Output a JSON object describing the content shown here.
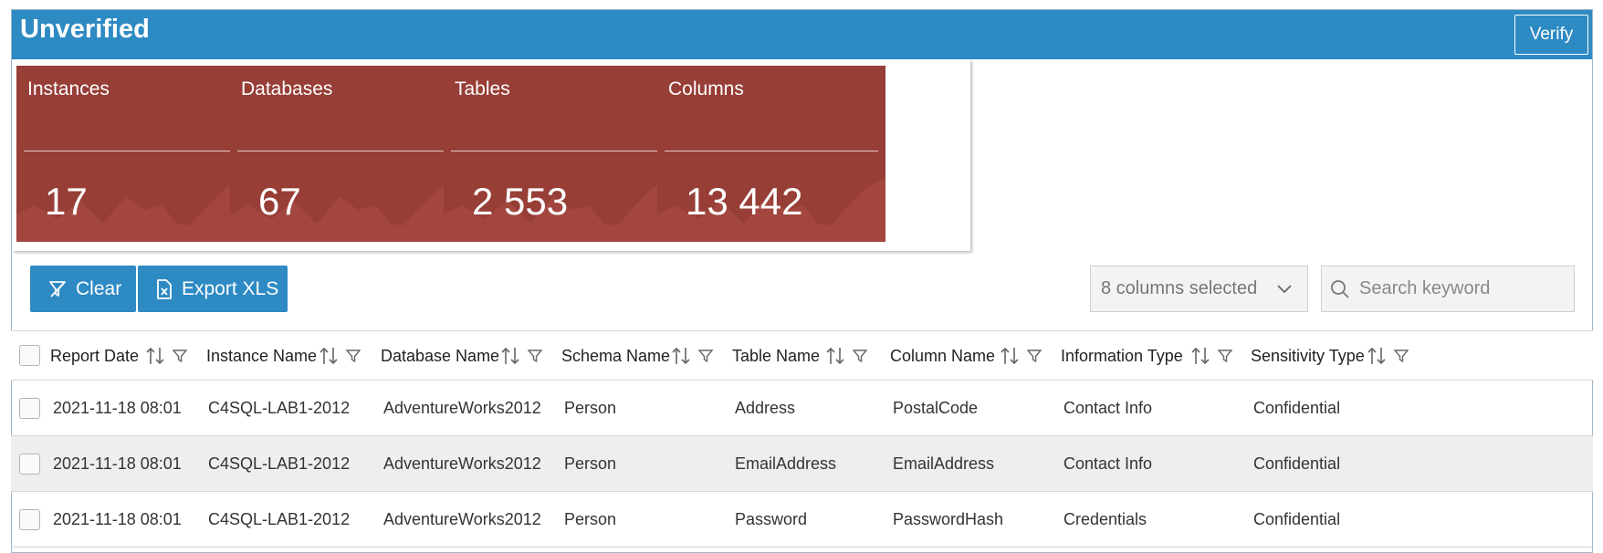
{
  "header": {
    "title": "Unverified",
    "verify_label": "Verify"
  },
  "tiles": [
    {
      "label": "Instances",
      "value": "17"
    },
    {
      "label": "Databases",
      "value": "67"
    },
    {
      "label": "Tables",
      "value": "2 553"
    },
    {
      "label": "Columns",
      "value": "13 442"
    }
  ],
  "toolbar": {
    "clear_label": "Clear",
    "export_label": "Export XLS",
    "columns_selected": "8 columns selected",
    "search_placeholder": "Search keyword"
  },
  "table": {
    "columns": [
      "Report Date",
      "Instance Name",
      "Database Name",
      "Schema Name",
      "Table Name",
      "Column Name",
      "Information Type",
      "Sensitivity Type"
    ],
    "rows": [
      [
        "2021-11-18 08:01",
        "C4SQL-LAB1-2012",
        "AdventureWorks2012",
        "Person",
        "Address",
        "PostalCode",
        "Contact Info",
        "Confidential"
      ],
      [
        "2021-11-18 08:01",
        "C4SQL-LAB1-2012",
        "AdventureWorks2012",
        "Person",
        "EmailAddress",
        "EmailAddress",
        "Contact Info",
        "Confidential"
      ],
      [
        "2021-11-18 08:01",
        "C4SQL-LAB1-2012",
        "AdventureWorks2012",
        "Person",
        "Password",
        "PasswordHash",
        "Credentials",
        "Confidential"
      ]
    ]
  },
  "colors": {
    "header": "#2e8ac3",
    "tile": "#973e37",
    "alt_row": "#eeeeee"
  },
  "icons": [
    "filter-clear-icon",
    "excel-file-icon",
    "chevron-down-icon",
    "search-icon",
    "sort-icon",
    "filter-icon"
  ]
}
